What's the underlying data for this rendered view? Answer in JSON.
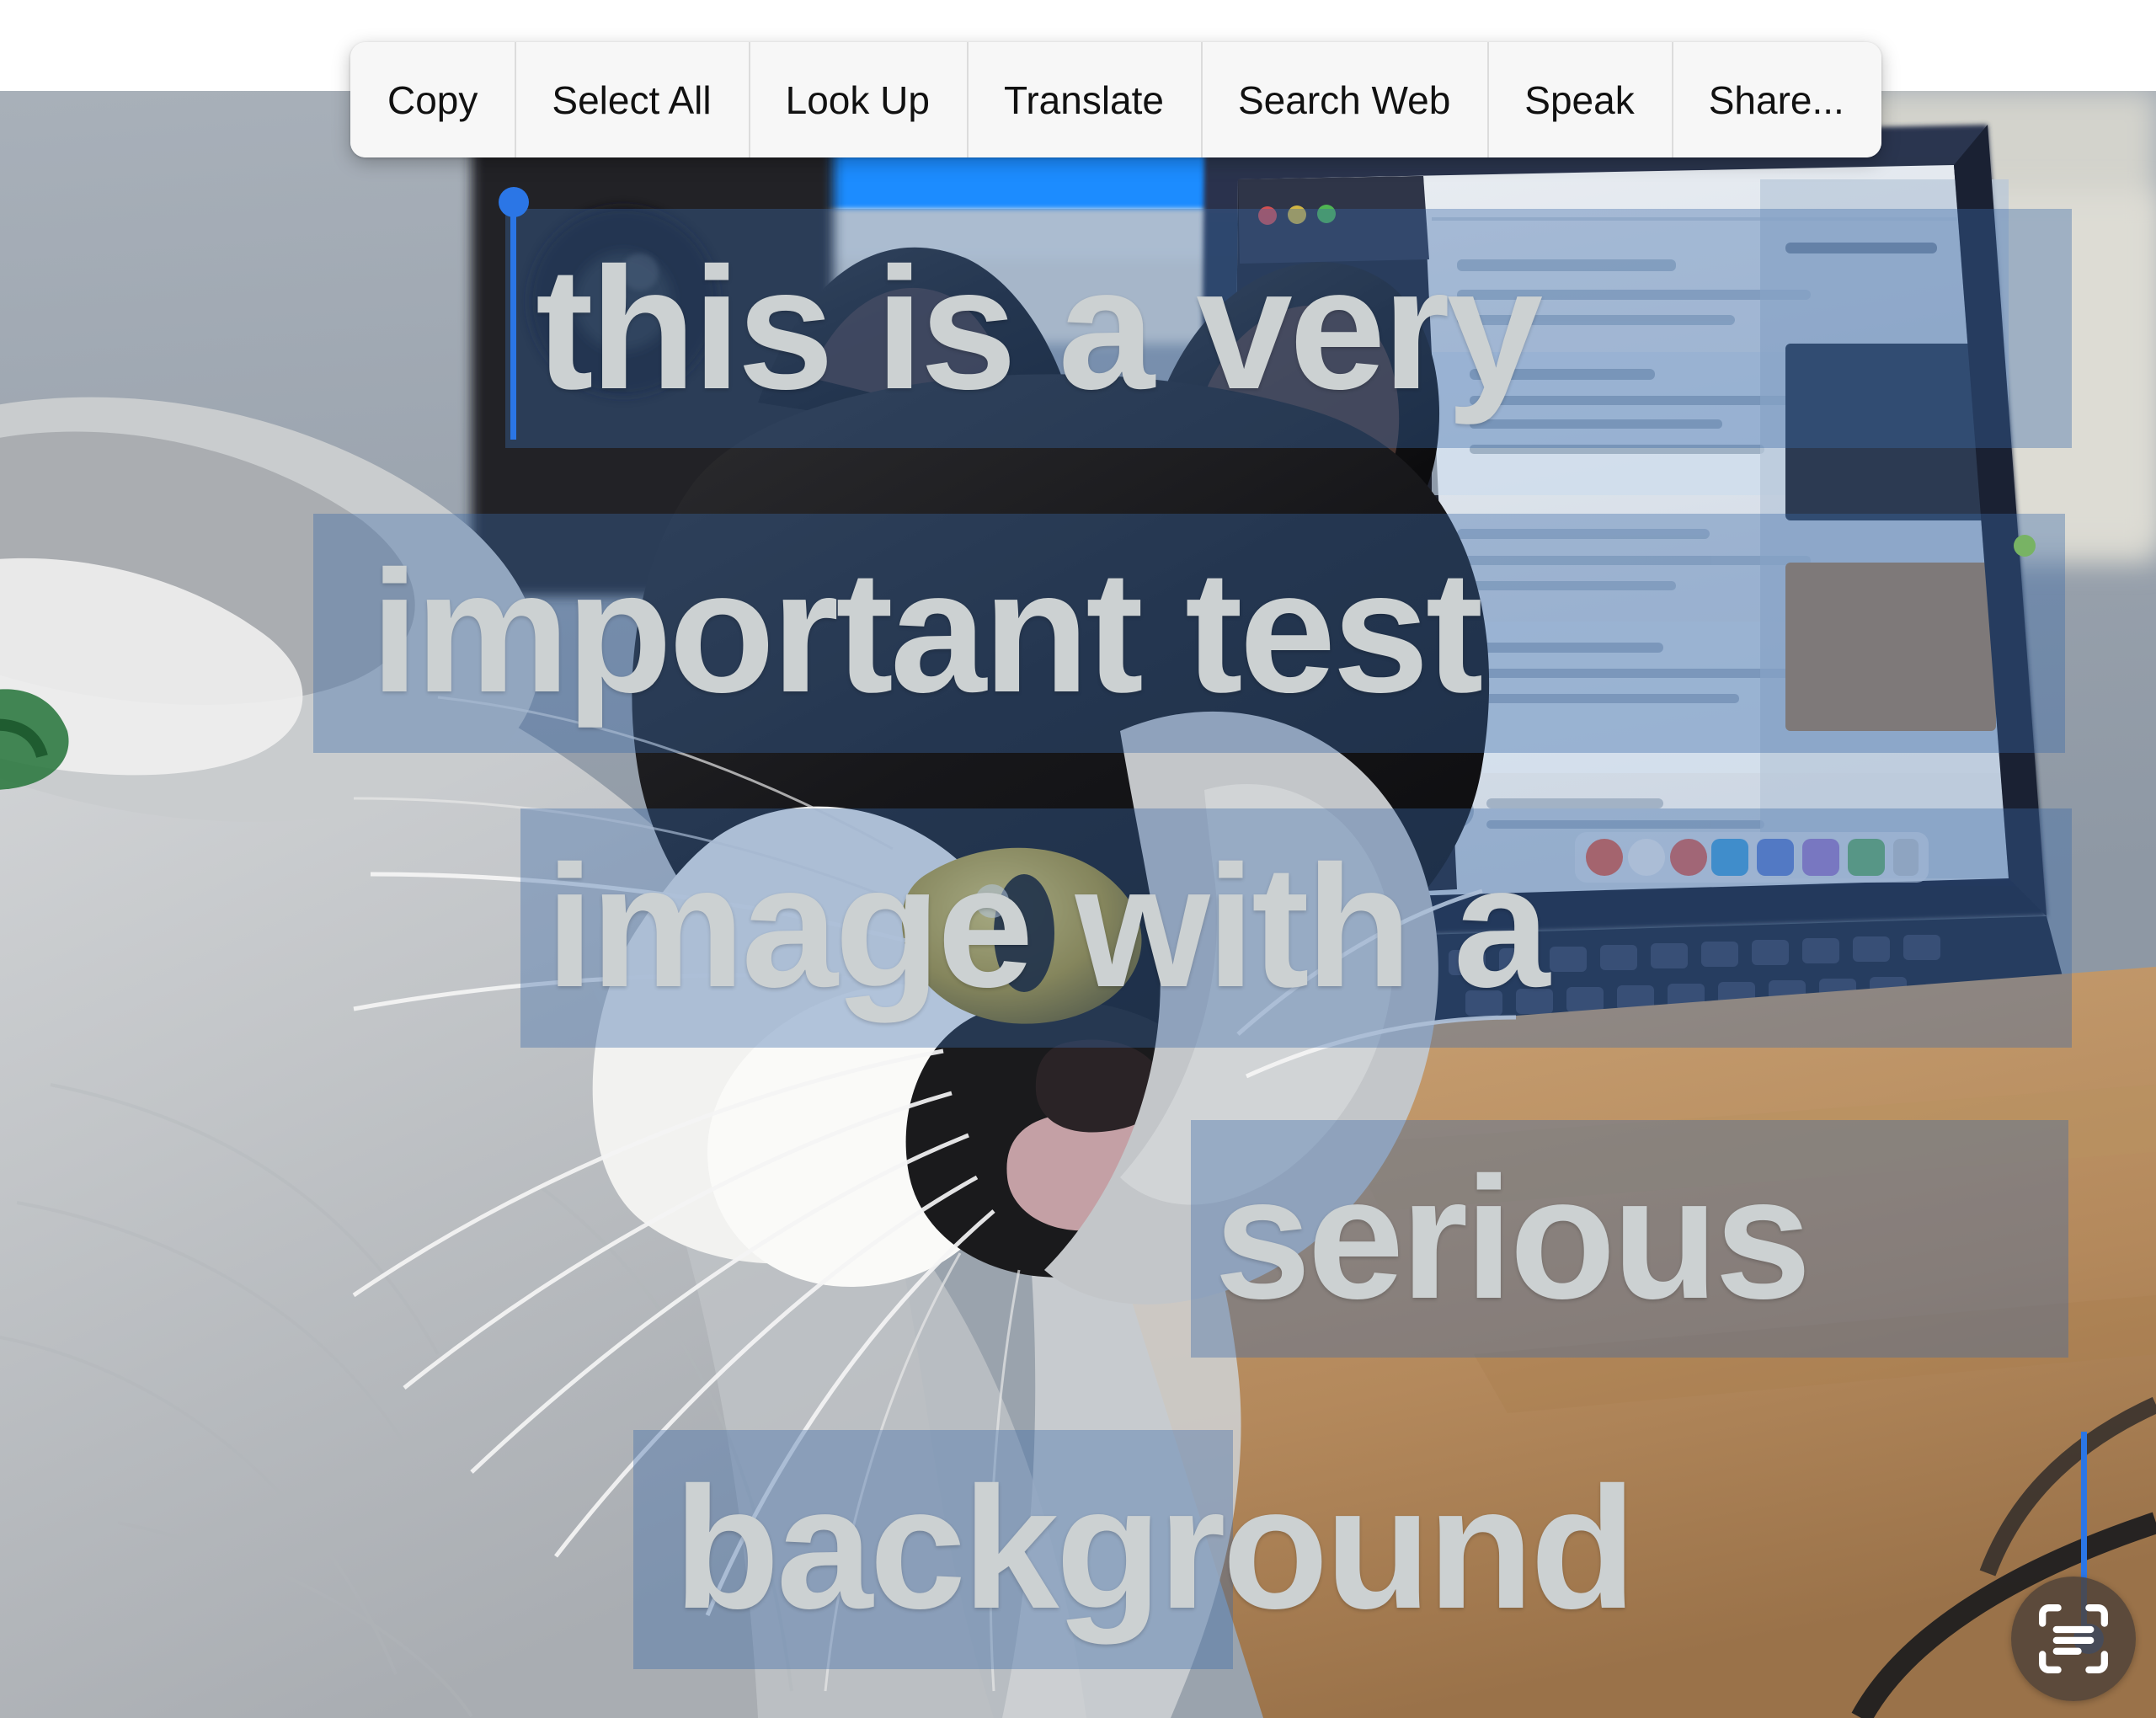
{
  "context_menu": {
    "items": [
      {
        "label": "Copy",
        "name": "menu-item-copy"
      },
      {
        "label": "Select All",
        "name": "menu-item-select-all"
      },
      {
        "label": "Look Up",
        "name": "menu-item-look-up"
      },
      {
        "label": "Translate",
        "name": "menu-item-translate"
      },
      {
        "label": "Search Web",
        "name": "menu-item-search-web"
      },
      {
        "label": "Speak",
        "name": "menu-item-speak"
      },
      {
        "label": "Share...",
        "name": "menu-item-share"
      }
    ]
  },
  "selected_text": {
    "full": "this is a very important test image with a serious background",
    "lines": [
      {
        "text": "this is a very"
      },
      {
        "text": "important test"
      },
      {
        "text": "image with a"
      },
      {
        "text": "serious"
      },
      {
        "text": "background"
      }
    ]
  },
  "colors": {
    "selection_highlight": "#3a68a8",
    "selection_handle": "#2b76e6",
    "overlay_text": "#ccd1d2",
    "menu_background": "#f7f7f7",
    "menu_text": "#111111",
    "livetext_button": "#4e4238"
  },
  "icons": {
    "live_text": "live-text-scan-icon"
  }
}
